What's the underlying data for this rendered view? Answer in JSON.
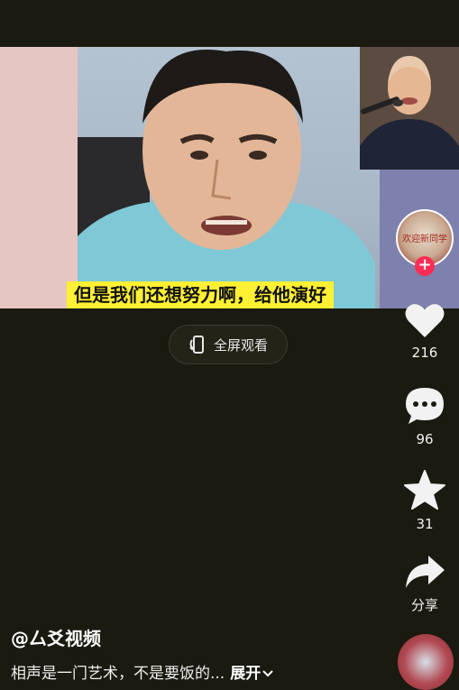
{
  "video": {
    "subtitle": "但是我们还想努力啊，给他演好",
    "inset_alt": ""
  },
  "fullscreen": {
    "label": "全屏观看",
    "icon": "rotate-screen-icon"
  },
  "sidebar": {
    "avatar_text": "欢迎新同学",
    "follow_icon": "plus-icon",
    "like": {
      "icon": "heart-icon",
      "count": "216"
    },
    "comment": {
      "icon": "comment-icon",
      "count": "96"
    },
    "favorite": {
      "icon": "star-icon",
      "count": "31"
    },
    "share": {
      "icon": "share-arrow-icon",
      "label": "分享"
    }
  },
  "post": {
    "username": "@厶爻视频",
    "description": "相声是一门艺术，不是要饭的...",
    "expand_label": "展开"
  },
  "colors": {
    "caption_bg": "#fff033",
    "follow_red": "#fe2c55",
    "page_bg": "#1b1a10"
  }
}
